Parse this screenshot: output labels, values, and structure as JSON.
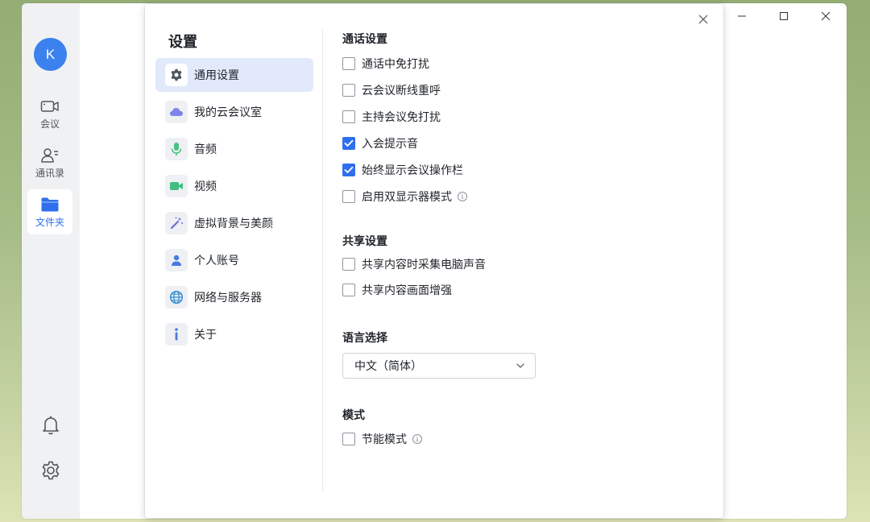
{
  "app": {
    "user_initial": "K",
    "rail": [
      {
        "label": "会议",
        "icon": "video-camera-icon"
      },
      {
        "label": "通讯录",
        "icon": "contacts-icon"
      },
      {
        "label": "文件夹",
        "icon": "folder-icon"
      }
    ],
    "bottom_icons": [
      "bell-icon",
      "gear-icon"
    ],
    "window_controls": [
      "minimize-icon",
      "maximize-icon",
      "close-icon"
    ]
  },
  "settings": {
    "title": "设置",
    "nav": [
      {
        "label": "通用设置",
        "icon": "gear-icon",
        "active": true
      },
      {
        "label": "我的云会议室",
        "icon": "cloud-icon"
      },
      {
        "label": "音频",
        "icon": "microphone-icon"
      },
      {
        "label": "视频",
        "icon": "video-camera-icon"
      },
      {
        "label": "虚拟背景与美颜",
        "icon": "magic-wand-icon"
      },
      {
        "label": "个人账号",
        "icon": "person-icon"
      },
      {
        "label": "网络与服务器",
        "icon": "globe-icon"
      },
      {
        "label": "关于",
        "icon": "info-icon"
      }
    ],
    "sections": {
      "call": {
        "title": "通话设置",
        "options": [
          {
            "label": "通话中免打扰",
            "checked": false
          },
          {
            "label": "云会议断线重呼",
            "checked": false
          },
          {
            "label": "主持会议免打扰",
            "checked": false
          },
          {
            "label": "入会提示音",
            "checked": true
          },
          {
            "label": "始终显示会议操作栏",
            "checked": true
          },
          {
            "label": "启用双显示器模式",
            "checked": false,
            "info": true
          }
        ]
      },
      "share": {
        "title": "共享设置",
        "options": [
          {
            "label": "共享内容时采集电脑声音",
            "checked": false
          },
          {
            "label": "共享内容画面增强",
            "checked": false
          }
        ]
      },
      "language": {
        "title": "语言选择",
        "selected": "中文（简体）"
      },
      "mode": {
        "title": "模式",
        "options": [
          {
            "label": "节能模式",
            "checked": false,
            "info": true
          }
        ]
      }
    },
    "colors": {
      "accent": "#2f6fed",
      "nav_active_bg": "#e1e9fb"
    }
  }
}
